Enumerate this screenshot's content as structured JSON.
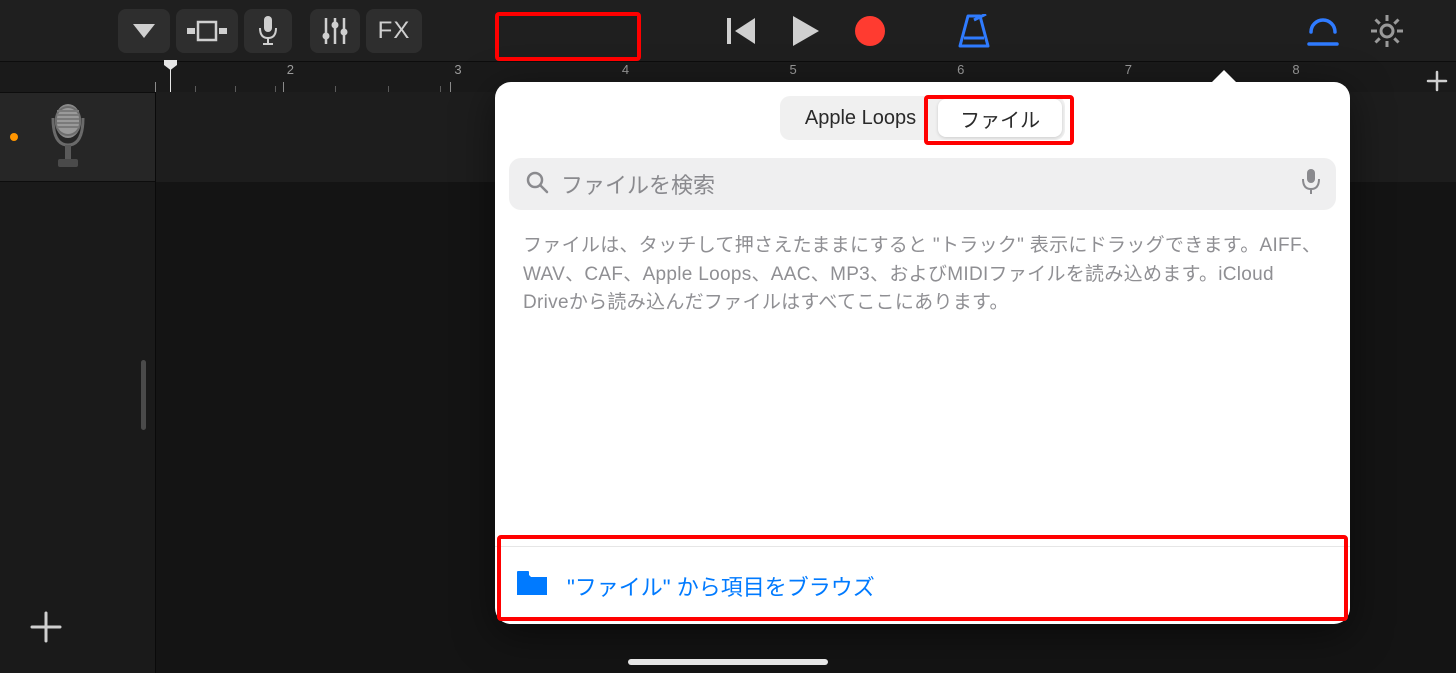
{
  "toolbar": {
    "fx_label": "FX"
  },
  "timeline": {
    "bars": [
      "2",
      "3",
      "4",
      "5",
      "6",
      "7",
      "8"
    ]
  },
  "popover": {
    "tabs": {
      "loops": "Apple Loops",
      "files": "ファイル"
    },
    "search_placeholder": "ファイルを検索",
    "help_text": "ファイルは、タッチして押さえたままにすると \"トラック\" 表示にドラッグできます。AIFF、WAV、CAF、Apple Loops、AAC、MP3、およびMIDIファイルを読み込めます。iCloud Driveから読み込んだファイルはすべてここにあります。",
    "browse_label": "\"ファイル\" から項目をブラウズ"
  },
  "colors": {
    "accent_blue": "#007aff",
    "record_red": "#ff3b30",
    "loop_blue": "#2f7bff"
  }
}
